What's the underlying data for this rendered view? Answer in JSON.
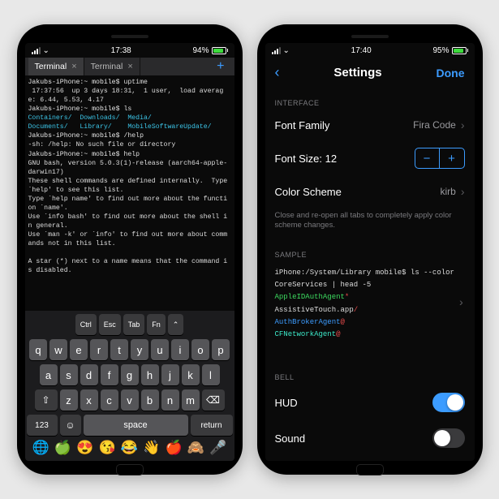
{
  "left": {
    "status": {
      "time": "17:38",
      "battery": "94%"
    },
    "tabs": {
      "t1": "Terminal",
      "t2": "Terminal"
    },
    "term": {
      "l1_host": "Jakubs-iPhone:~ mobile$",
      "l1_cmd": "uptime",
      "l2": " 17:37:56  up 3 days 18:31,  1 user,  load average: 6.44, 5.53, 4.17",
      "l3_host": "Jakubs-iPhone:~ mobile$",
      "l3_cmd": "ls",
      "l4a": "Containers/",
      "l4b": "Downloads/",
      "l4c": "Media/",
      "l5a": "Documents/",
      "l5b": "Library/",
      "l5c": "MobileSoftwareUpdate/",
      "l6_host": "Jakubs-iPhone:~ mobile$",
      "l6_cmd": "/help",
      "l7": "-sh: /help: No such file or directory",
      "l8_host": "Jakubs-iPhone:~ mobile$",
      "l8_cmd": "help",
      "l9": "GNU bash, version 5.0.3(1)-release (aarch64-apple-darwin17)",
      "l10": "These shell commands are defined internally.  Type `help' to see this list.",
      "l11": "Type `help name' to find out more about the function `name'.",
      "l12": "Use `info bash' to find out more about the shell in general.",
      "l13": "Use `man -k' or `info' to find out more about commands not in this list.",
      "l14": "A star (*) next to a name means that the command is disabled."
    },
    "keyboard": {
      "fn": {
        "ctrl": "Ctrl",
        "esc": "Esc",
        "tab": "Tab",
        "fnk": "Fn"
      },
      "r1": [
        "q",
        "w",
        "e",
        "r",
        "t",
        "y",
        "u",
        "i",
        "o",
        "p"
      ],
      "r2": [
        "a",
        "s",
        "d",
        "f",
        "g",
        "h",
        "j",
        "k",
        "l"
      ],
      "r3": [
        "z",
        "x",
        "c",
        "v",
        "b",
        "n",
        "m"
      ],
      "num": "123",
      "space": "space",
      "return": "return",
      "emoji": [
        "🌐",
        "🍏",
        "😍",
        "😘",
        "😂",
        "👋",
        "🍎",
        "🙈",
        "🎤"
      ]
    }
  },
  "right": {
    "status": {
      "time": "17:40",
      "battery": "95%"
    },
    "nav": {
      "title": "Settings",
      "done": "Done"
    },
    "sections": {
      "interface": "INTERFACE",
      "sample": "SAMPLE",
      "bell": "BELL"
    },
    "rows": {
      "fontFamily": {
        "label": "Font Family",
        "value": "Fira Code"
      },
      "fontSize": {
        "label": "Font Size: 12"
      },
      "colorScheme": {
        "label": "Color Scheme",
        "value": "kirb"
      },
      "hud": {
        "label": "HUD"
      },
      "sound": {
        "label": "Sound"
      }
    },
    "footer": "Close and re-open all tabs to completely apply color scheme changes.",
    "sample": {
      "l1": "iPhone:/System/Library mobile$ ls --color CoreServices | head -5",
      "l2a": "AppleIDAuthAgent",
      "l2b": "*",
      "l3a": "AssistiveTouch.app",
      "l3b": "/",
      "l4a": "AuthBrokerAgent",
      "l4b": "@",
      "l5a": "CFNetworkAgent",
      "l5b": "@"
    }
  }
}
